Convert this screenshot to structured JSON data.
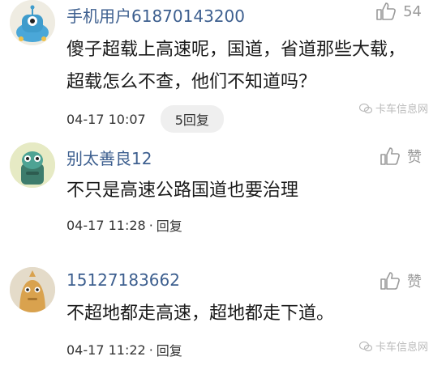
{
  "comments": [
    {
      "username": "手机用户61870143200",
      "likes": "54",
      "text": "傻子超载上高速呢，国道，省道那些大载，超载怎么不查，他们不知道吗？",
      "timestamp": "04-17 10:07",
      "separator": "",
      "reply_label": "5回复",
      "watermark": "卡车信息网"
    },
    {
      "username": "别太善良12",
      "likes": "赞",
      "text": "不只是高速公路国道也要治理",
      "timestamp": "04-17 11:28",
      "separator": "·",
      "reply_label": "回复"
    },
    {
      "username": "15127183662",
      "likes": "赞",
      "text": "不超地都走高速，超地都走下道。",
      "timestamp": "04-17 11:22",
      "separator": "·",
      "reply_label": "回复",
      "watermark": "卡车信息网"
    }
  ],
  "colors": {
    "username": "#3d5f8f",
    "meta": "#333333",
    "reply_pill_bg": "#efefef",
    "like": "#9a9a9a"
  }
}
